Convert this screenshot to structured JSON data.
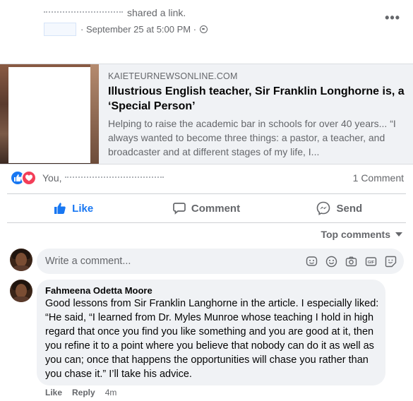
{
  "post": {
    "author_action": "shared a link.",
    "timestamp": "September 25 at 5:00 PM",
    "separator": "·",
    "more_label": "•••"
  },
  "link_card": {
    "domain": "KAIETEURNEWSONLINE.COM",
    "title": "Illustrious English teacher, Sir Franklin Longhorne is, a ‘Special Person’",
    "description": "Helping to raise the academic bar in schools for over 40 years... “I always wanted to become three things: a pastor, a teacher, and broadcaster and at different stages of my life, I..."
  },
  "reactions": {
    "names_prefix": "You,",
    "comment_count": "1 Comment"
  },
  "actions": {
    "like": "Like",
    "comment": "Comment",
    "send": "Send"
  },
  "comments_section": {
    "sort_label": "Top comments",
    "write_placeholder": "Write a comment...",
    "comments": [
      {
        "author": "Fahmeena Odetta Moore",
        "text": "Good lessons from Sir Franklin Langhorne in the article. I especially liked: “He said, “I learned from Dr. Myles Munroe whose teaching I hold in high regard that once you find you like something and you are good at it, then you refine it to a point where you believe that nobody can do it as well as you can; once that happens the opportunities will chase you rather than you chase it.” I’ll take his advice.",
        "like_label": "Like",
        "reply_label": "Reply",
        "time": "4m"
      }
    ]
  },
  "colors": {
    "accent": "#1877f2",
    "love": "#f33e58",
    "secondary_text": "#65676b",
    "bubble_bg": "#f0f2f5"
  },
  "icons": [
    "globe-icon",
    "more-icon",
    "like-reaction-icon",
    "love-reaction-icon",
    "like-icon",
    "comment-icon",
    "messenger-icon",
    "emoji-icon",
    "camera-icon",
    "gif-icon",
    "sticker-icon",
    "avatar-icon"
  ]
}
